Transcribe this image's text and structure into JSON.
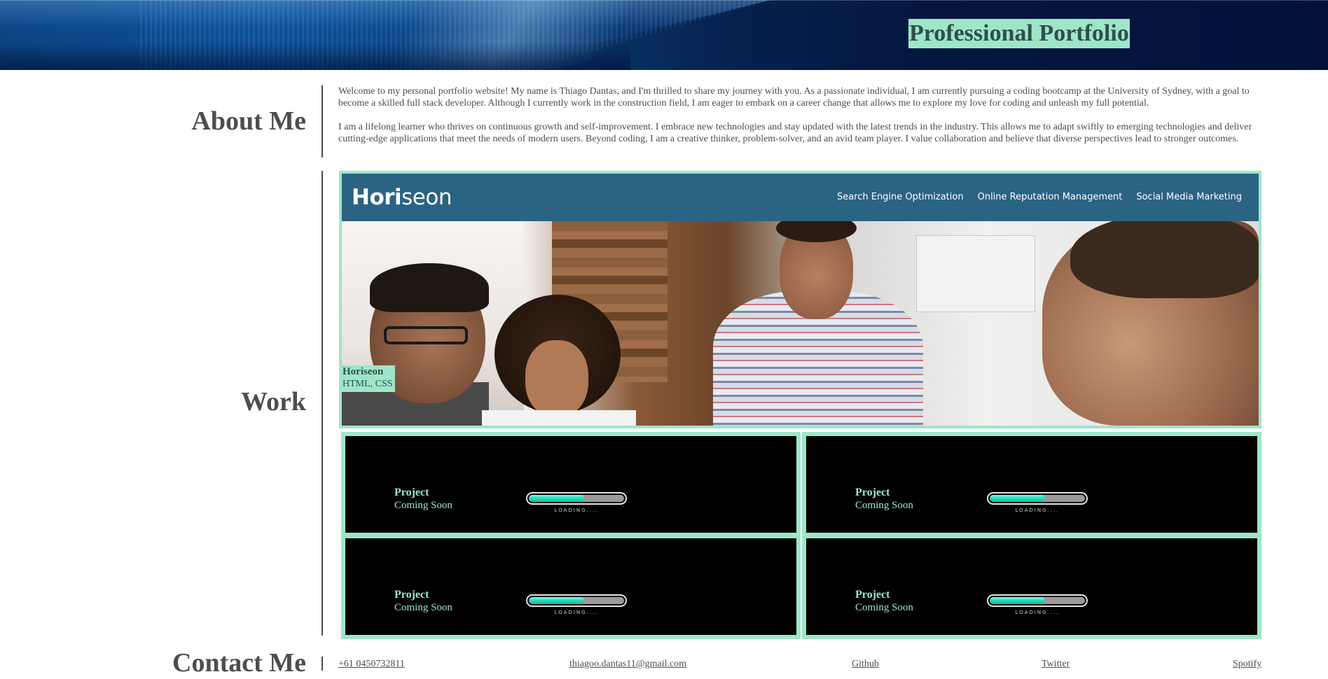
{
  "header": {
    "title": "Professional Portfolio"
  },
  "about": {
    "heading": "About Me",
    "paragraphs": [
      "Welcome to my personal portfolio website! My name is Thiago Dantas, and I'm thrilled to share my journey with you. As a passionate individual, I am currently pursuing a coding bootcamp at the University of Sydney, with a goal to become a skilled full stack developer. Although I currently work in the construction field, I am eager to embark on a career change that allows me to explore my love for coding and unleash my full potential.",
      "I am a lifelong learner who thrives on continuous growth and self-improvement. I embrace new technologies and stay updated with the latest trends in the industry. This allows me to adapt swiftly to emerging technologies and deliver cutting-edge applications that meet the needs of modern users. Beyond coding, I am a creative thinker, problem-solver, and an avid team player. I value collaboration and believe that diverse perspectives lead to stronger outcomes."
    ]
  },
  "work": {
    "heading": "Work",
    "featured": {
      "logo_bold": "Hori",
      "logo_light": "seon",
      "nav": [
        "Search Engine Optimization",
        "Online Reputation Management",
        "Social Media Marketing"
      ],
      "title": "Horiseon",
      "subtitle": "HTML, CSS"
    },
    "projects": [
      {
        "title": "Project",
        "subtitle": "Coming Soon",
        "loading_text": "LOADING....",
        "progress": 0.58
      },
      {
        "title": "Project",
        "subtitle": "Coming Soon",
        "loading_text": "LOADING....",
        "progress": 0.58
      },
      {
        "title": "Project",
        "subtitle": "Coming Soon",
        "loading_text": "LOADING....",
        "progress": 0.58
      },
      {
        "title": "Project",
        "subtitle": "Coming Soon",
        "loading_text": "LOADING....",
        "progress": 0.58
      }
    ]
  },
  "contact": {
    "heading": "Contact Me",
    "links": [
      {
        "label": "+61 0450732811"
      },
      {
        "label": "thiagoo.dantas11@gmail.com"
      },
      {
        "label": "Github"
      },
      {
        "label": "Twitter"
      },
      {
        "label": "Spotify"
      }
    ]
  },
  "colors": {
    "accent": "#9ee6c8",
    "heading": "#4d4d4d",
    "horiseon_nav": "#2b6383",
    "loader_fill": "#1fdcbc"
  }
}
